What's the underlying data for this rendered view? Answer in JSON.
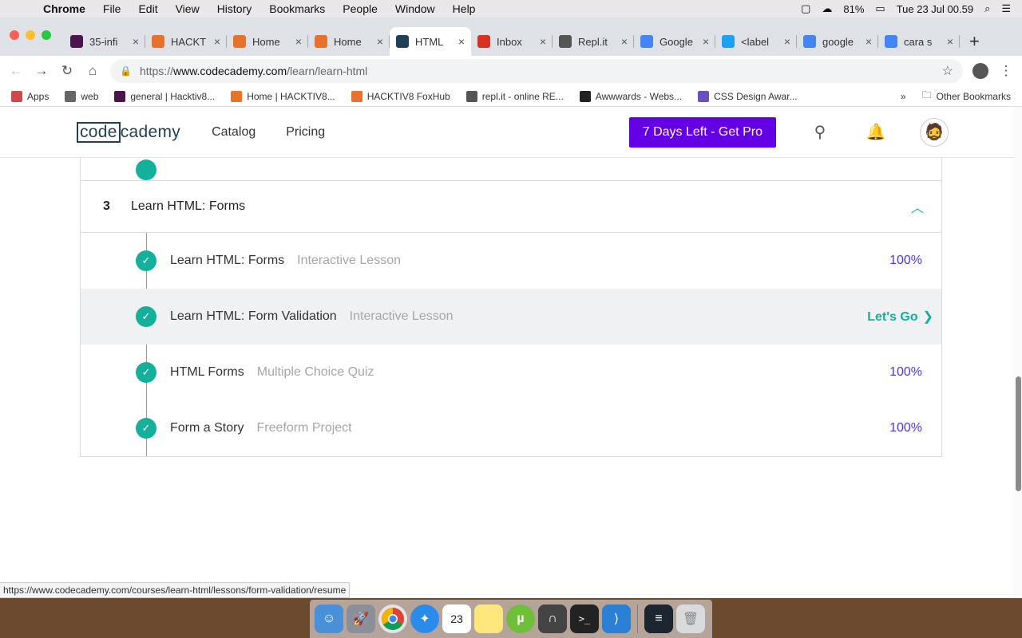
{
  "menubar": {
    "apple": "",
    "items": [
      "Chrome",
      "File",
      "Edit",
      "View",
      "History",
      "Bookmarks",
      "People",
      "Window",
      "Help"
    ],
    "battery": "81%",
    "clock": "Tue 23 Jul  00.59"
  },
  "tabs": [
    {
      "label": "35-infi",
      "color": "#4a154b"
    },
    {
      "label": "HACKT",
      "color": "#e8712b"
    },
    {
      "label": "Home",
      "color": "#e8712b"
    },
    {
      "label": "Home",
      "color": "#e8712b"
    },
    {
      "label": "HTML",
      "color": "#1f4056"
    },
    {
      "label": "Inbox",
      "color": "#d93025"
    },
    {
      "label": "Repl.it",
      "color": "#555555"
    },
    {
      "label": "Google",
      "color": "#4285f4"
    },
    {
      "label": "<label",
      "color": "#1da1f2"
    },
    {
      "label": "google",
      "color": "#4285f4"
    },
    {
      "label": "cara s",
      "color": "#4285f4"
    }
  ],
  "newtab": "+",
  "omnibox": {
    "url_prefix": "https://",
    "url_host": "www.codecademy.com",
    "url_path": "/learn/learn-html"
  },
  "bookmarks": {
    "items": [
      {
        "label": "Apps",
        "color": "#c94b4b"
      },
      {
        "label": "web",
        "color": "#666666"
      },
      {
        "label": "general | Hacktiv8...",
        "color": "#4a154b"
      },
      {
        "label": "Home | HACKTIV8...",
        "color": "#e8712b"
      },
      {
        "label": "HACKTIV8 FoxHub",
        "color": "#e8712b"
      },
      {
        "label": "repl.it - online RE...",
        "color": "#555555"
      },
      {
        "label": "Awwwards - Webs...",
        "color": "#222222"
      },
      {
        "label": "CSS Design Awar...",
        "color": "#6b4fbb"
      }
    ],
    "overflow": "»",
    "other": "Other Bookmarks"
  },
  "header": {
    "logo_boxed": "code",
    "logo_rest": "cademy",
    "nav": [
      "Catalog",
      "Pricing"
    ],
    "cta": "7 Days Left - Get Pro"
  },
  "module": {
    "number": "3",
    "title": "Learn HTML: Forms",
    "lessons": [
      {
        "title": "Learn HTML: Forms",
        "type": "Interactive Lesson",
        "status": "100%",
        "highlight": false
      },
      {
        "title": "Learn HTML: Form Validation",
        "type": "Interactive Lesson",
        "status": "Let's Go",
        "highlight": true
      },
      {
        "title": "HTML Forms",
        "type": "Multiple Choice Quiz",
        "status": "100%",
        "highlight": false
      },
      {
        "title": "Form a Story",
        "type": "Freeform Project",
        "status": "100%",
        "highlight": false
      }
    ]
  },
  "status_url": "https://www.codecademy.com/courses/learn-html/lessons/form-validation/resume",
  "dock": {
    "calendar_day": "23",
    "icons": [
      "finder-icon",
      "launchpad-icon",
      "chrome-icon",
      "safari-icon",
      "calendar-icon",
      "notes-icon",
      "utorrent-icon",
      "tunnel-icon",
      "terminal-icon",
      "vscode-icon",
      "console-icon",
      "trash-icon"
    ]
  },
  "colors": {
    "accent_purple": "#6400e4",
    "teal": "#15b09b",
    "percent_blue": "#4b35ef"
  }
}
